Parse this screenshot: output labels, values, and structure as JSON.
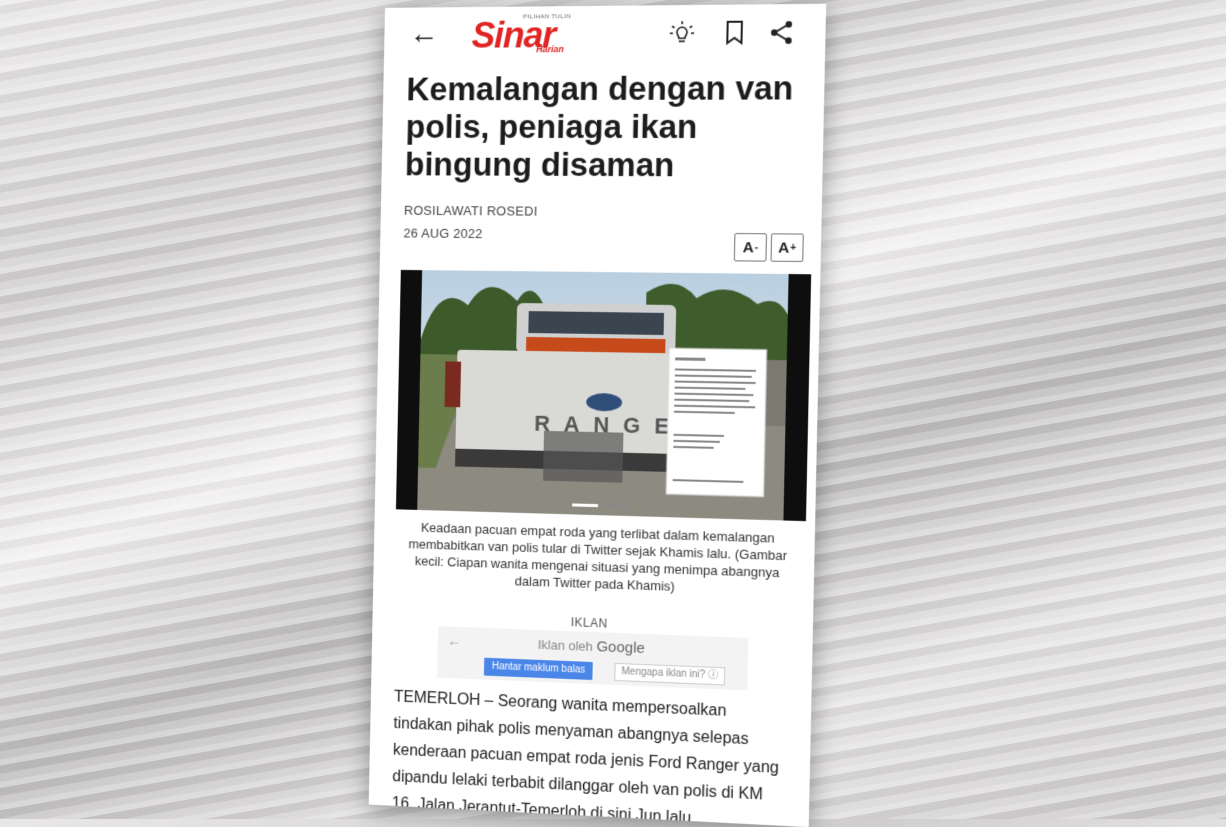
{
  "app": {
    "logo_main": "Sinar",
    "logo_sub": "Harian",
    "logo_tag": "PILIHAN TULIN"
  },
  "toolbar": {
    "back_icon": "arrow-left-icon",
    "bulb_icon": "lightbulb-icon",
    "bookmark_icon": "bookmark-icon",
    "share_icon": "share-icon"
  },
  "article": {
    "title": "Kemalangan dengan van polis, peniaga ikan bingung disaman",
    "author": "ROSILAWATI ROSEDI",
    "date": "26 AUG 2022",
    "font_decrease": "A",
    "font_increase": "A",
    "caption": "Keadaan pacuan empat roda yang terlibat dalam kemalangan membabitkan van polis tular di Twitter sejak Khamis lalu. (Gambar kecil: Ciapan wanita mengenai situasi yang menimpa abangnya dalam Twitter pada Khamis)",
    "body": "TEMERLOH – Seorang wanita mempersoalkan tindakan pihak polis menyaman abangnya selepas kenderaan pacuan empat roda jenis Ford Ranger yang dipandu lelaki terbabit dilanggar oleh van polis di KM 16, Jalan Jerantut-Temerloh di sini Jun lalu."
  },
  "ad": {
    "heading": "IKLAN",
    "label_prefix": "Iklan oleh",
    "label_brand": "Google",
    "feedback_button": "Hantar maklum balas",
    "why_button": "Mengapa iklan ini? ⓘ"
  },
  "colors": {
    "brand": "#e02323",
    "ad_button": "#4a86e8"
  }
}
